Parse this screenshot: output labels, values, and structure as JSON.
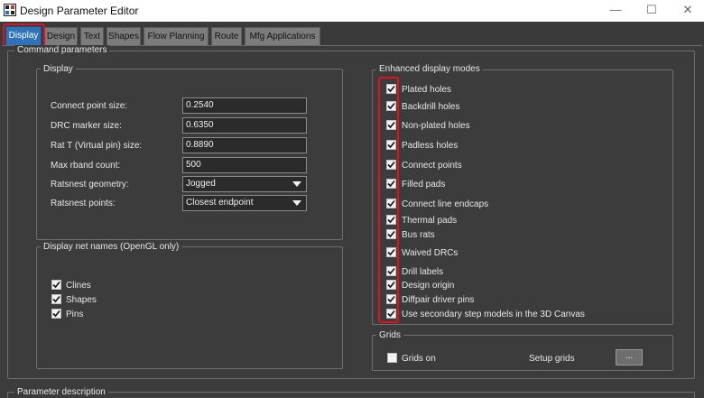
{
  "window": {
    "title": "Design Parameter Editor"
  },
  "tabs": [
    "Display",
    "Design",
    "Text",
    "Shapes",
    "Flow Planning",
    "Route",
    "Mfg Applications"
  ],
  "command_parameters": {
    "label": "Command parameters"
  },
  "display": {
    "label": "Display",
    "fields": [
      {
        "label": "Connect point size:",
        "value": "0.2540"
      },
      {
        "label": "DRC marker size:",
        "value": "0.6350"
      },
      {
        "label": "Rat T (Virtual pin) size:",
        "value": "0.8890"
      },
      {
        "label": "Max rband count:",
        "value": "500"
      }
    ],
    "selects": [
      {
        "label": "Ratsnest geometry:",
        "value": "Jogged"
      },
      {
        "label": "Ratsnest points:",
        "value": "Closest endpoint"
      }
    ]
  },
  "net_names": {
    "label": "Display net names (OpenGL only)",
    "items": [
      {
        "label": "Clines",
        "checked": true
      },
      {
        "label": "Shapes",
        "checked": true
      },
      {
        "label": "Pins",
        "checked": true
      }
    ]
  },
  "enhanced": {
    "label": "Enhanced display modes",
    "items": [
      {
        "label": "Plated holes",
        "checked": true
      },
      {
        "label": "Backdrill holes",
        "checked": true
      },
      {
        "label": "Non-plated holes",
        "checked": true
      },
      {
        "label": "Padless holes",
        "checked": true
      },
      {
        "label": "Connect points",
        "checked": true
      },
      {
        "label": "Filled pads",
        "checked": true
      },
      {
        "label": "Connect line endcaps",
        "checked": true
      },
      {
        "label": "Thermal pads",
        "checked": true
      },
      {
        "label": "Bus rats",
        "checked": true
      },
      {
        "label": "Waived DRCs",
        "checked": true
      },
      {
        "label": "Drill labels",
        "checked": true
      },
      {
        "label": "Design origin",
        "checked": true
      },
      {
        "label": "Diffpair driver pins",
        "checked": true
      },
      {
        "label": "Use secondary step models in the 3D Canvas",
        "checked": true
      }
    ]
  },
  "grids": {
    "label": "Grids",
    "grids_on": {
      "label": "Grids on",
      "checked": false
    },
    "setup_label": "Setup grids",
    "setup_button": "..."
  },
  "parameter_description": {
    "label": "Parameter description"
  }
}
